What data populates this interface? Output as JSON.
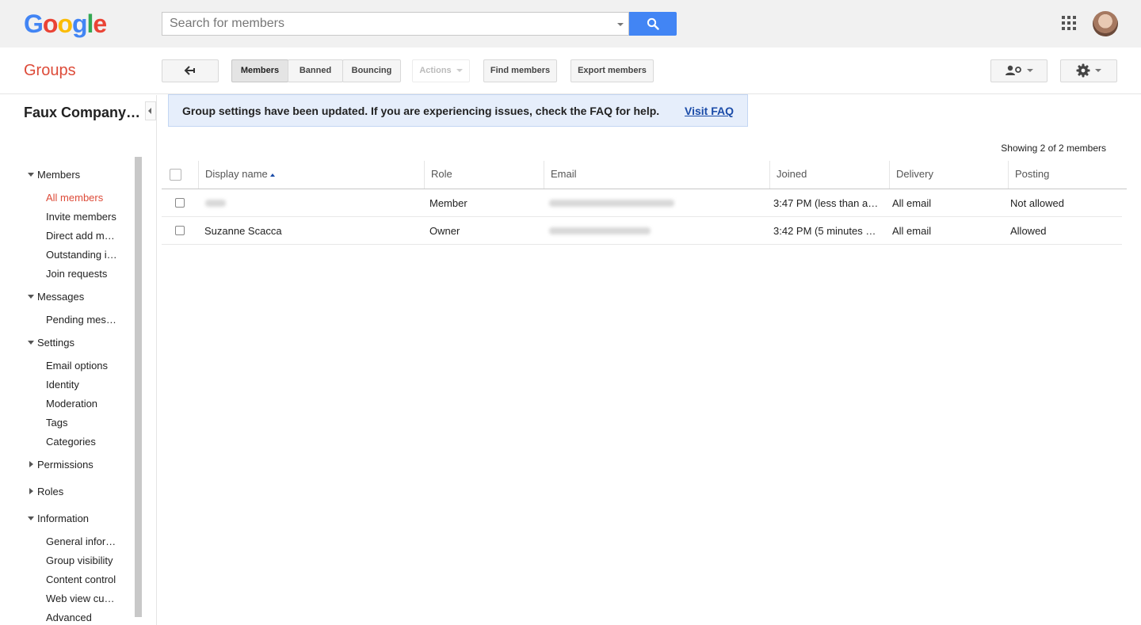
{
  "header": {
    "logo_letters": [
      "G",
      "o",
      "o",
      "g",
      "l",
      "e"
    ],
    "search_placeholder": "Search for members",
    "search_icon": "search-icon",
    "apps_icon": "apps-grid-icon",
    "avatar_icon": "account-avatar"
  },
  "toolbar": {
    "app_name": "Groups",
    "back_icon": "back-arrow-icon",
    "tabs": [
      "Members",
      "Banned",
      "Bouncing"
    ],
    "actions_label": "Actions",
    "find_members": "Find members",
    "export_members": "Export members",
    "people_settings_icon": "person-settings-icon",
    "settings_icon": "gear-icon"
  },
  "sidebar": {
    "group_name": "Faux Company…",
    "sections": [
      {
        "label": "Members",
        "expanded": true,
        "items": [
          "All members",
          "Invite members",
          "Direct add m…",
          "Outstanding i…",
          "Join requests"
        ]
      },
      {
        "label": "Messages",
        "expanded": true,
        "items": [
          "Pending mes…"
        ]
      },
      {
        "label": "Settings",
        "expanded": true,
        "items": [
          "Email options",
          "Identity",
          "Moderation",
          "Tags",
          "Categories"
        ]
      },
      {
        "label": "Permissions",
        "expanded": false,
        "items": []
      },
      {
        "label": "Roles",
        "expanded": false,
        "items": []
      },
      {
        "label": "Information",
        "expanded": true,
        "items": [
          "General infor…",
          "Group visibility",
          "Content control",
          "Web view cu…",
          "Advanced"
        ]
      }
    ],
    "active_item": "All members"
  },
  "banner": {
    "message": "Group settings have been updated. If you are experiencing issues, check the FAQ for help.",
    "link": "Visit FAQ"
  },
  "table": {
    "showing": "Showing 2 of 2 members",
    "columns": [
      "Display name",
      "Role",
      "Email",
      "Joined",
      "Delivery",
      "Posting"
    ],
    "rows": [
      {
        "name": "",
        "role": "Member",
        "email": "",
        "joined": "3:47 PM (less than a…",
        "delivery": "All email",
        "posting": "Not allowed"
      },
      {
        "name": "Suzanne Scacca",
        "role": "Owner",
        "email": "",
        "joined": "3:42 PM (5 minutes …",
        "delivery": "All email",
        "posting": "Allowed"
      }
    ]
  },
  "colors": {
    "accent_red": "#dd4b39",
    "search_blue": "#4285f4",
    "link_blue": "#1a4ba8",
    "banner_bg": "#e6eefb"
  }
}
